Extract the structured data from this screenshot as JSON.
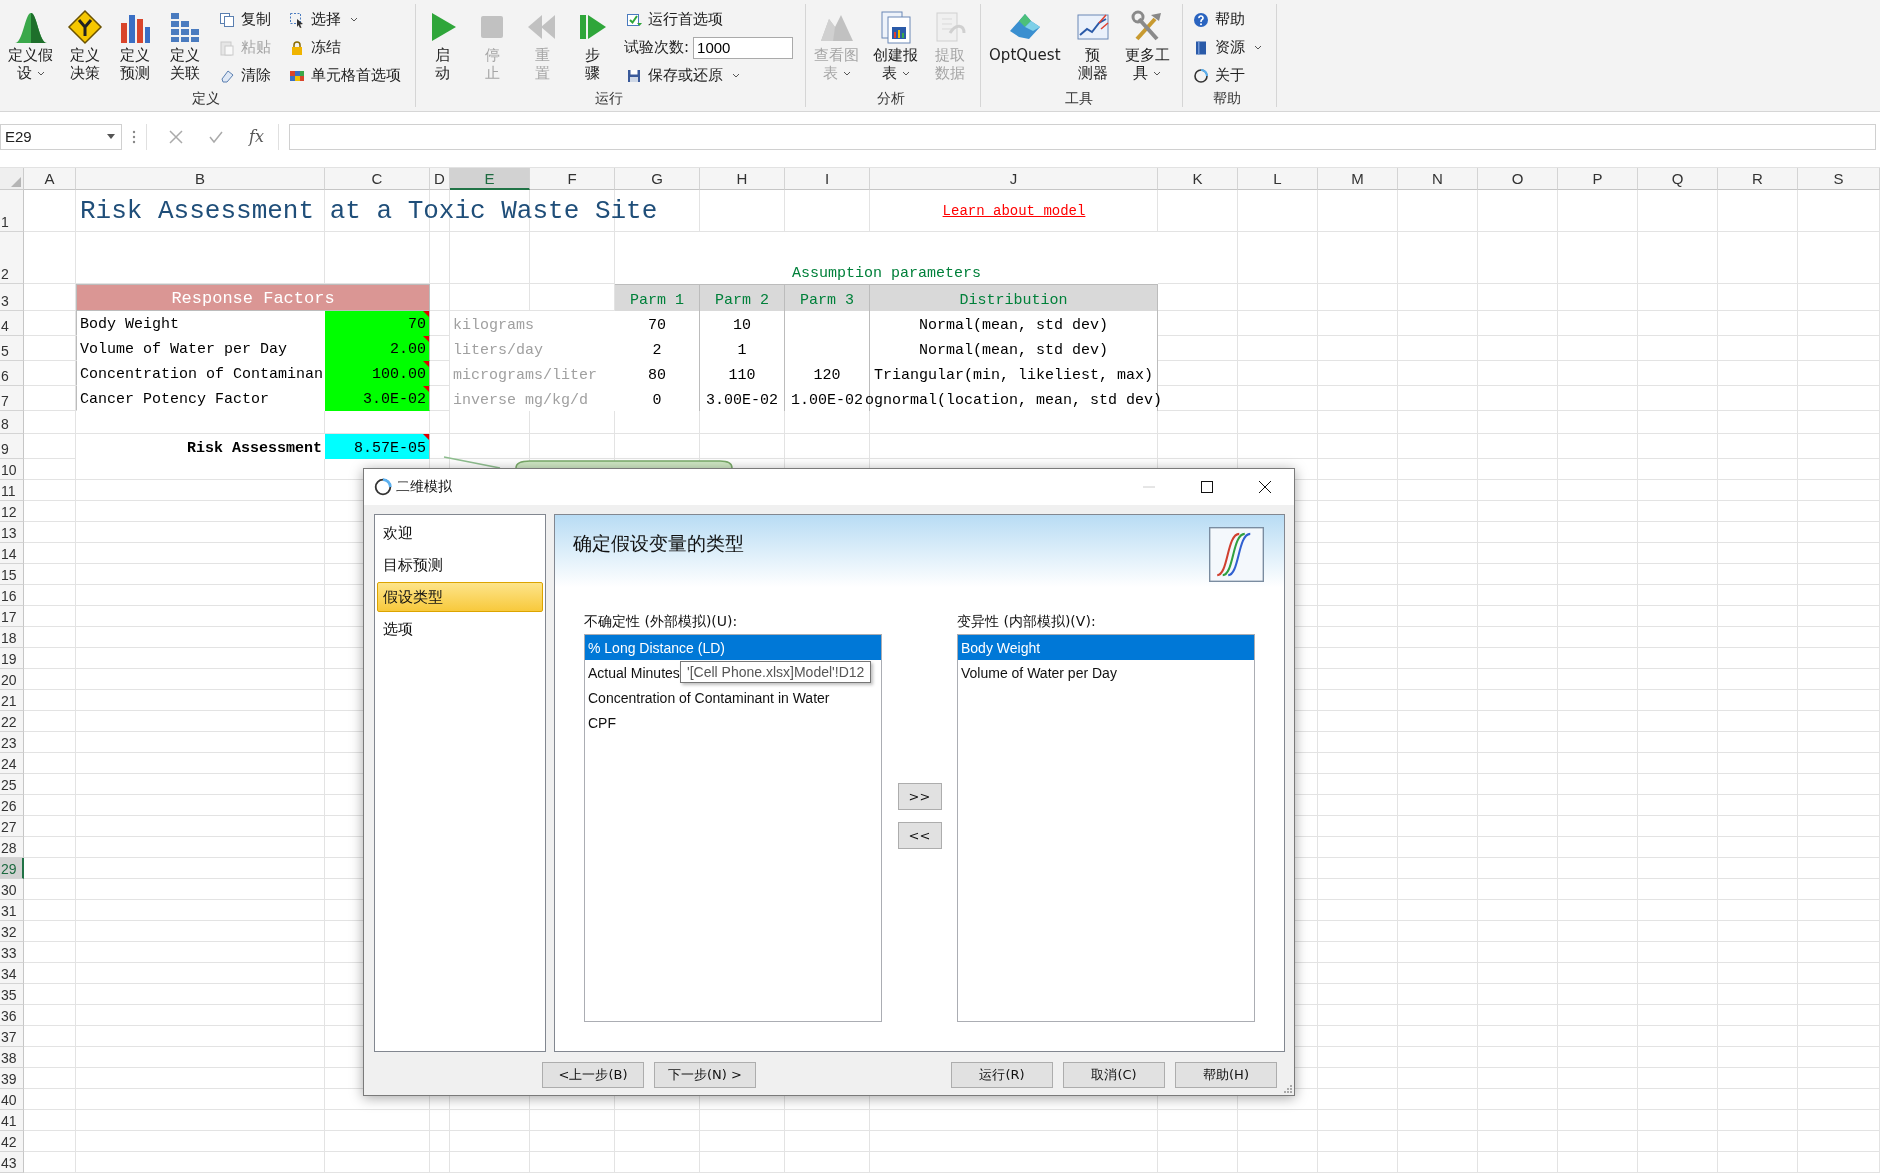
{
  "ribbon": {
    "groups": [
      {
        "label": "定义",
        "items": [
          {
            "kind": "large",
            "lines": [
              "定义假",
              "设"
            ],
            "dropdown": true,
            "disabled": false
          },
          {
            "kind": "large",
            "lines": [
              "定义",
              "决策"
            ],
            "dropdown": false,
            "disabled": false
          },
          {
            "kind": "large",
            "lines": [
              "定义",
              "预测"
            ],
            "dropdown": false,
            "disabled": false
          },
          {
            "kind": "large",
            "lines": [
              "定义",
              "关联"
            ],
            "dropdown": false,
            "disabled": false
          },
          {
            "kind": "stack",
            "items": [
              {
                "kind": "small",
                "label": "复制",
                "dropdown": false,
                "disabled": false
              },
              {
                "kind": "small",
                "label": "粘贴",
                "dropdown": false,
                "disabled": true
              },
              {
                "kind": "small",
                "label": "清除",
                "dropdown": false,
                "disabled": false
              }
            ]
          },
          {
            "kind": "stack",
            "items": [
              {
                "kind": "small",
                "label": "选择",
                "dropdown": true,
                "disabled": false
              },
              {
                "kind": "small",
                "label": "冻结",
                "dropdown": false,
                "disabled": false
              },
              {
                "kind": "small",
                "label": "单元格首选项",
                "dropdown": false,
                "disabled": false
              }
            ]
          }
        ]
      },
      {
        "label": "运行",
        "items": [
          {
            "kind": "large",
            "lines": [
              "启",
              "动"
            ],
            "dropdown": false,
            "disabled": false
          },
          {
            "kind": "large",
            "lines": [
              "停",
              "止"
            ],
            "dropdown": false,
            "disabled": true
          },
          {
            "kind": "large",
            "lines": [
              "重",
              "置"
            ],
            "dropdown": false,
            "disabled": true
          },
          {
            "kind": "large",
            "lines": [
              "步",
              "骤"
            ],
            "dropdown": false,
            "disabled": false
          },
          {
            "kind": "stack",
            "items": [
              {
                "kind": "small",
                "label": "运行首选项",
                "dropdown": false,
                "disabled": false
              },
              {
                "kind": "field",
                "label": "试验次数:",
                "value": "1000"
              },
              {
                "kind": "small",
                "label": "保存或还原",
                "dropdown": true,
                "disabled": false
              }
            ]
          }
        ]
      },
      {
        "label": "分析",
        "items": [
          {
            "kind": "large",
            "lines": [
              "查看图",
              "表"
            ],
            "dropdown": true,
            "disabled": true
          },
          {
            "kind": "large",
            "lines": [
              "创建报",
              "表"
            ],
            "dropdown": true,
            "disabled": false
          },
          {
            "kind": "large",
            "lines": [
              "提取",
              "数据"
            ],
            "dropdown": false,
            "disabled": true
          }
        ]
      },
      {
        "label": "工具",
        "items": [
          {
            "kind": "large",
            "lines": [
              "OptQuest"
            ],
            "dropdown": false,
            "disabled": false
          },
          {
            "kind": "large",
            "lines": [
              "预",
              "测器"
            ],
            "dropdown": false,
            "disabled": false
          },
          {
            "kind": "large",
            "lines": [
              "更多工",
              "具"
            ],
            "dropdown": true,
            "disabled": false
          }
        ]
      },
      {
        "label": "帮助",
        "items": [
          {
            "kind": "stack",
            "items": [
              {
                "kind": "small",
                "label": "帮助",
                "dropdown": false,
                "disabled": false
              },
              {
                "kind": "small",
                "label": "资源",
                "dropdown": true,
                "disabled": false
              },
              {
                "kind": "small",
                "label": "关于",
                "dropdown": false,
                "disabled": false
              }
            ]
          }
        ]
      }
    ]
  },
  "formula_bar": {
    "name_box": "E29",
    "function_label": "fx"
  },
  "columns": [
    {
      "label": "A",
      "selected": false
    },
    {
      "label": "B",
      "selected": false
    },
    {
      "label": "C",
      "selected": false
    },
    {
      "label": "D",
      "selected": false
    },
    {
      "label": "E",
      "selected": true
    },
    {
      "label": "F",
      "selected": false
    },
    {
      "label": "G",
      "selected": false
    },
    {
      "label": "H",
      "selected": false
    },
    {
      "label": "I",
      "selected": false
    },
    {
      "label": "J",
      "selected": false
    },
    {
      "label": "K",
      "selected": false
    },
    {
      "label": "L",
      "selected": false
    },
    {
      "label": "M",
      "selected": false
    },
    {
      "label": "N",
      "selected": false
    },
    {
      "label": "O",
      "selected": false
    },
    {
      "label": "P",
      "selected": false
    },
    {
      "label": "Q",
      "selected": false
    },
    {
      "label": "R",
      "selected": false
    },
    {
      "label": "S",
      "selected": false
    }
  ],
  "rows": [
    {
      "label": "1",
      "selected": false
    },
    {
      "label": "2",
      "selected": false
    },
    {
      "label": "3",
      "selected": false
    },
    {
      "label": "4",
      "selected": false
    },
    {
      "label": "5",
      "selected": false
    },
    {
      "label": "6",
      "selected": false
    },
    {
      "label": "7",
      "selected": false
    },
    {
      "label": "8",
      "selected": false
    },
    {
      "label": "9",
      "selected": false
    },
    {
      "label": "10",
      "selected": false
    },
    {
      "label": "11",
      "selected": false
    },
    {
      "label": "12",
      "selected": false
    },
    {
      "label": "13",
      "selected": false
    },
    {
      "label": "14",
      "selected": false
    },
    {
      "label": "15",
      "selected": false
    },
    {
      "label": "16",
      "selected": false
    },
    {
      "label": "17",
      "selected": false
    },
    {
      "label": "18",
      "selected": false
    },
    {
      "label": "19",
      "selected": false
    },
    {
      "label": "20",
      "selected": false
    },
    {
      "label": "21",
      "selected": false
    },
    {
      "label": "22",
      "selected": false
    },
    {
      "label": "23",
      "selected": false
    },
    {
      "label": "24",
      "selected": false
    },
    {
      "label": "25",
      "selected": false
    },
    {
      "label": "26",
      "selected": false
    },
    {
      "label": "27",
      "selected": false
    },
    {
      "label": "28",
      "selected": false
    },
    {
      "label": "29",
      "selected": true
    },
    {
      "label": "30",
      "selected": false
    },
    {
      "label": "31",
      "selected": false
    },
    {
      "label": "32",
      "selected": false
    },
    {
      "label": "33",
      "selected": false
    },
    {
      "label": "34",
      "selected": false
    },
    {
      "label": "35",
      "selected": false
    },
    {
      "label": "36",
      "selected": false
    },
    {
      "label": "37",
      "selected": false
    },
    {
      "label": "38",
      "selected": false
    },
    {
      "label": "39",
      "selected": false
    },
    {
      "label": "40",
      "selected": false
    },
    {
      "label": "41",
      "selected": false
    },
    {
      "label": "42",
      "selected": false
    },
    {
      "label": "43",
      "selected": false
    }
  ],
  "sheet": {
    "title": "Risk Assessment at a Toxic Waste Site",
    "link": "Learn about model",
    "response_factors": {
      "heading": "Response Factors",
      "rows": [
        {
          "label": "Body Weight",
          "value": "70",
          "unit": "kilograms",
          "has_comment": true
        },
        {
          "label": "Volume of Water per Day",
          "value": "2.00",
          "unit": "liters/day",
          "has_comment": true
        },
        {
          "label": "Concentration of Contaminan",
          "value": "100.00",
          "unit": "micrograms/liter",
          "has_comment": true
        },
        {
          "label": "Cancer Potency Factor",
          "value": "3.0E-02",
          "unit": "inverse mg/kg/d",
          "has_comment": true
        }
      ]
    },
    "risk_assessment": {
      "label": "Risk Assessment",
      "value": "8.57E-05",
      "has_comment": true
    },
    "assumptions": {
      "title": "Assumption parameters",
      "columns": [
        "Parm 1",
        "Parm 2",
        "Parm 3",
        "Distribution"
      ],
      "rows": [
        {
          "parm_1": "70",
          "parm_2": "10",
          "distribution": "Normal(mean, std dev)"
        },
        {
          "parm_1": "2",
          "parm_2": "1",
          "distribution": "Normal(mean, std dev)"
        },
        {
          "parm_1": "80",
          "parm_2": "110",
          "parm_3": "120",
          "distribution": "Triangular(min, likeliest, max)"
        },
        {
          "parm_1": "0",
          "parm_2": "3.00E-02",
          "parm_3": "1.00E-02",
          "distribution": "ognormal(location, mean, std dev)"
        }
      ]
    }
  },
  "dialog": {
    "title": "二维模拟",
    "nav": [
      {
        "label": "欢迎",
        "selected": false
      },
      {
        "label": "目标预测",
        "selected": false
      },
      {
        "label": "假设类型",
        "selected": true
      },
      {
        "label": "选项",
        "selected": false
      }
    ],
    "heading": "确定假设变量的类型",
    "uncertainty": {
      "label": "不确定性 (外部模拟)(U):",
      "items": [
        {
          "label": "% Long Distance (LD)",
          "selected": true
        },
        {
          "label": "Actual Minutes",
          "selected": false
        },
        {
          "label": "Concentration of Contaminant in Water",
          "selected": false
        },
        {
          "label": "CPF",
          "selected": false
        }
      ]
    },
    "variability": {
      "label": "变异性 (内部模拟)(V):",
      "items": [
        {
          "label": "Body Weight",
          "selected": true
        },
        {
          "label": "Volume of Water per Day",
          "selected": false
        }
      ]
    },
    "move_buttons": [
      ">>",
      "<<"
    ],
    "tooltip": "'[Cell Phone.xlsx]Model'!D12",
    "buttons": [
      "<上一步(B)",
      "下一步(N) >",
      "运行(R)",
      "取消(C)",
      "帮助(H)"
    ]
  }
}
